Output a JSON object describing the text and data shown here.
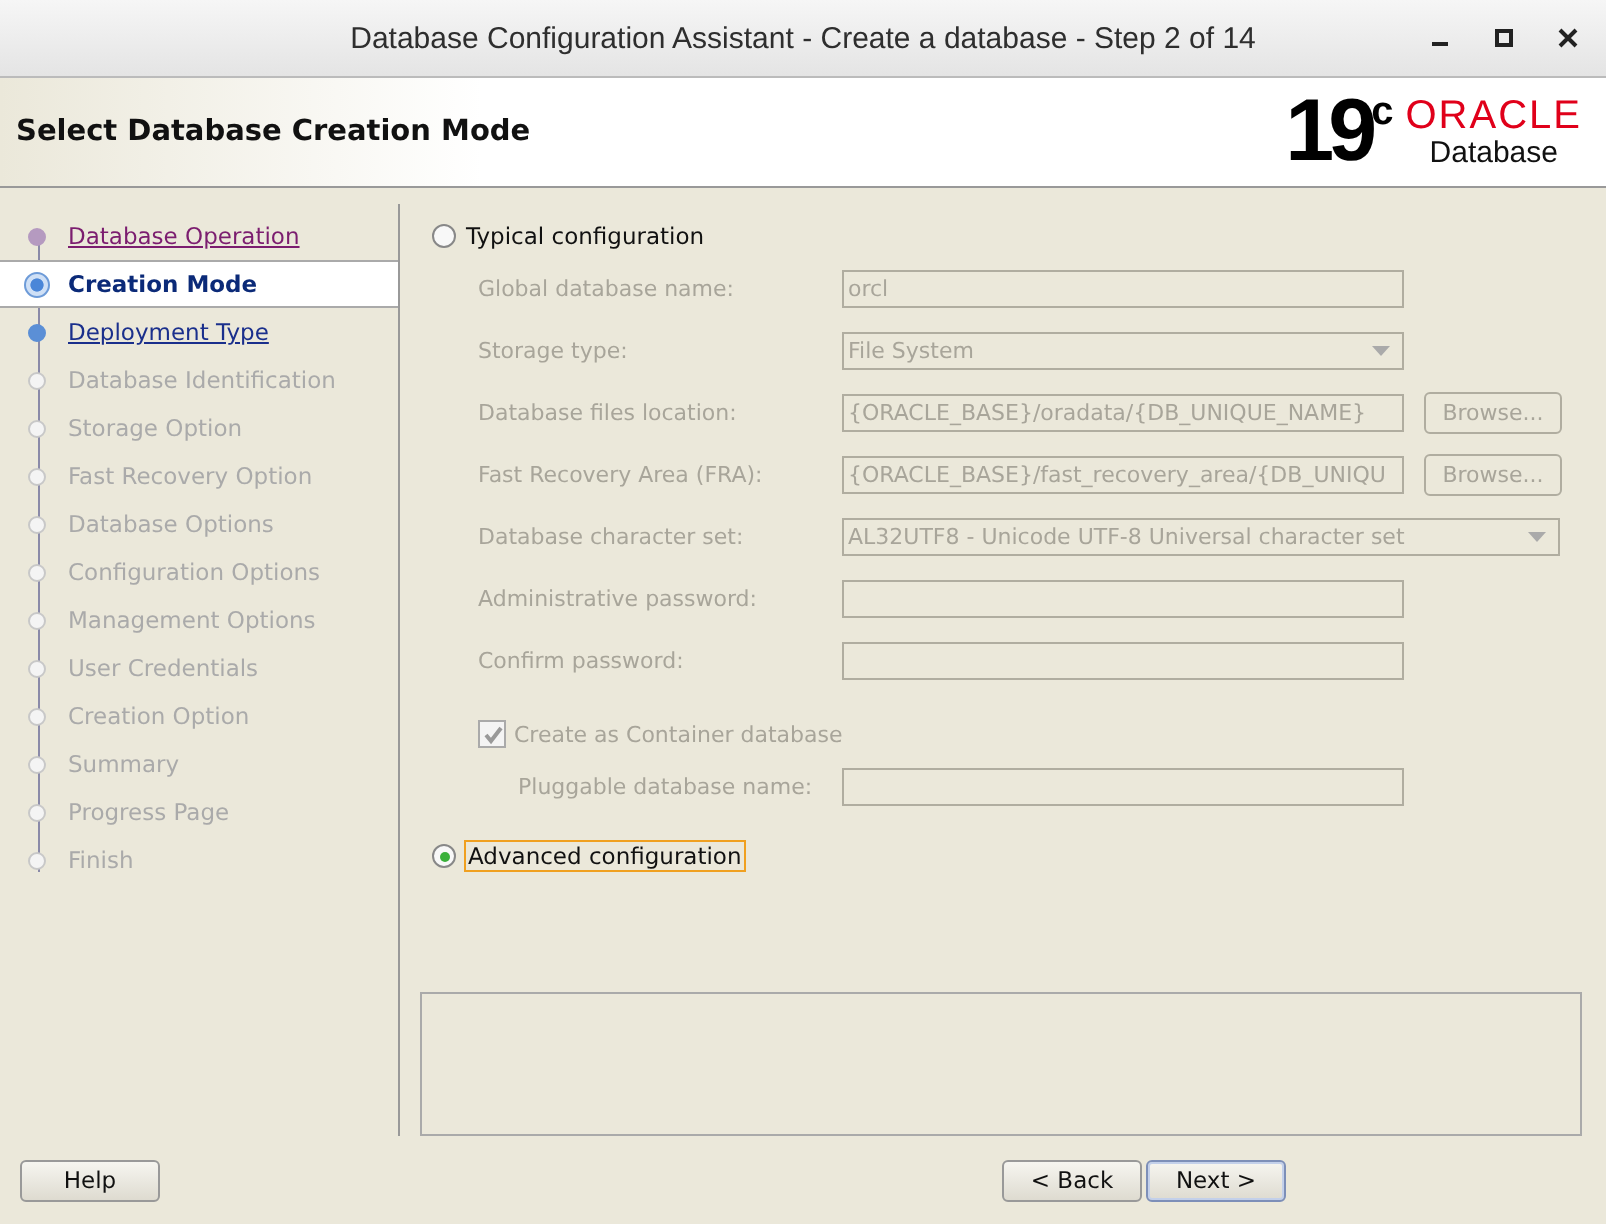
{
  "window": {
    "title": "Database Configuration Assistant - Create a database - Step 2 of 14"
  },
  "header": {
    "title": "Select Database Creation Mode",
    "logo_version": "19",
    "logo_sup": "c",
    "logo_brand": "ORACLE",
    "logo_product": "Database"
  },
  "steps": [
    {
      "label": "Database Operation",
      "kind": "visited",
      "selected": false
    },
    {
      "label": "Creation Mode",
      "kind": "current",
      "selected": true
    },
    {
      "label": "Deployment Type",
      "kind": "link",
      "selected": false
    },
    {
      "label": "Database Identification",
      "kind": "pending",
      "selected": false
    },
    {
      "label": "Storage Option",
      "kind": "pending",
      "selected": false
    },
    {
      "label": "Fast Recovery Option",
      "kind": "pending",
      "selected": false
    },
    {
      "label": "Database Options",
      "kind": "pending",
      "selected": false
    },
    {
      "label": "Configuration Options",
      "kind": "pending",
      "selected": false
    },
    {
      "label": "Management Options",
      "kind": "pending",
      "selected": false
    },
    {
      "label": "User Credentials",
      "kind": "pending",
      "selected": false
    },
    {
      "label": "Creation Option",
      "kind": "pending",
      "selected": false
    },
    {
      "label": "Summary",
      "kind": "pending",
      "selected": false
    },
    {
      "label": "Progress Page",
      "kind": "pending",
      "selected": false
    },
    {
      "label": "Finish",
      "kind": "pending",
      "selected": false
    }
  ],
  "typical": {
    "label": "Typical configuration",
    "selected": false
  },
  "fields": [
    {
      "label": "Global database name:",
      "kind": "text",
      "value": "orcl",
      "disabled": true
    },
    {
      "label": "Storage type:",
      "kind": "select",
      "value": "File System",
      "disabled": true
    },
    {
      "label": "Database files location:",
      "kind": "text",
      "value": "{ORACLE_BASE}/oradata/{DB_UNIQUE_NAME}",
      "button": "Browse...",
      "disabled": true
    },
    {
      "label": "Fast Recovery Area (FRA):",
      "kind": "text",
      "value": "{ORACLE_BASE}/fast_recovery_area/{DB_UNIQU",
      "button": "Browse...",
      "disabled": true
    },
    {
      "label": "Database character set:",
      "kind": "wide-select",
      "value": "AL32UTF8 - Unicode UTF-8 Universal character set",
      "disabled": true
    },
    {
      "label": "Administrative password:",
      "kind": "text",
      "disabled": true
    },
    {
      "label": "Confirm password:",
      "kind": "text",
      "disabled": true
    }
  ],
  "container": {
    "label": "Create as Container database",
    "checked": true,
    "disabled": true
  },
  "pluggable": {
    "label": "Pluggable database name:",
    "disabled": true
  },
  "advanced": {
    "label": "Advanced configuration",
    "selected": true
  },
  "buttons": {
    "help": "Help",
    "back": "< Back",
    "next": "Next >"
  }
}
